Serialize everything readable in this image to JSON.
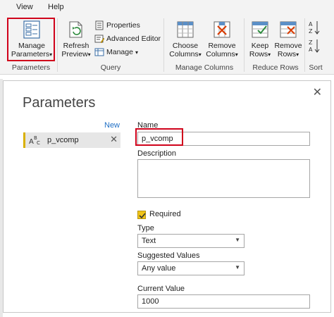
{
  "menu": [
    "View",
    "Help"
  ],
  "ribbon": {
    "manage_parameters": {
      "line1": "Manage",
      "line2": "Parameters",
      "caret": "▾"
    },
    "refresh_preview": {
      "line1": "Refresh",
      "line2": "Preview",
      "caret": "▾"
    },
    "properties": "Properties",
    "advanced_editor": "Advanced Editor",
    "manage": "Manage",
    "manage_caret": "▾",
    "choose_columns": {
      "line1": "Choose",
      "line2": "Columns",
      "caret": "▾"
    },
    "remove_columns": {
      "line1": "Remove",
      "line2": "Columns",
      "caret": "▾"
    },
    "keep_rows": {
      "line1": "Keep",
      "line2": "Rows",
      "caret": "▾"
    },
    "remove_rows": {
      "line1": "Remove",
      "line2": "Rows",
      "caret": "▾"
    },
    "groups": {
      "parameters": "Parameters",
      "query": "Query",
      "manage_columns": "Manage Columns",
      "reduce_rows": "Reduce Rows",
      "sort": "Sort"
    },
    "highlight_color": "#d0021b"
  },
  "dialog": {
    "title": "Parameters",
    "close_glyph": "✕",
    "new_link": "New",
    "parameter_item": {
      "type_icon": "ABC",
      "name": "p_vcomp",
      "delete_glyph": "✕"
    },
    "fields": {
      "name_label": "Name",
      "name_value": "p_vcomp",
      "description_label": "Description",
      "description_value": "",
      "required_label": "Required",
      "required_checked": true,
      "type_label": "Type",
      "type_value": "Text",
      "suggested_label": "Suggested Values",
      "suggested_value": "Any value",
      "current_label": "Current Value",
      "current_value": "1000"
    }
  }
}
